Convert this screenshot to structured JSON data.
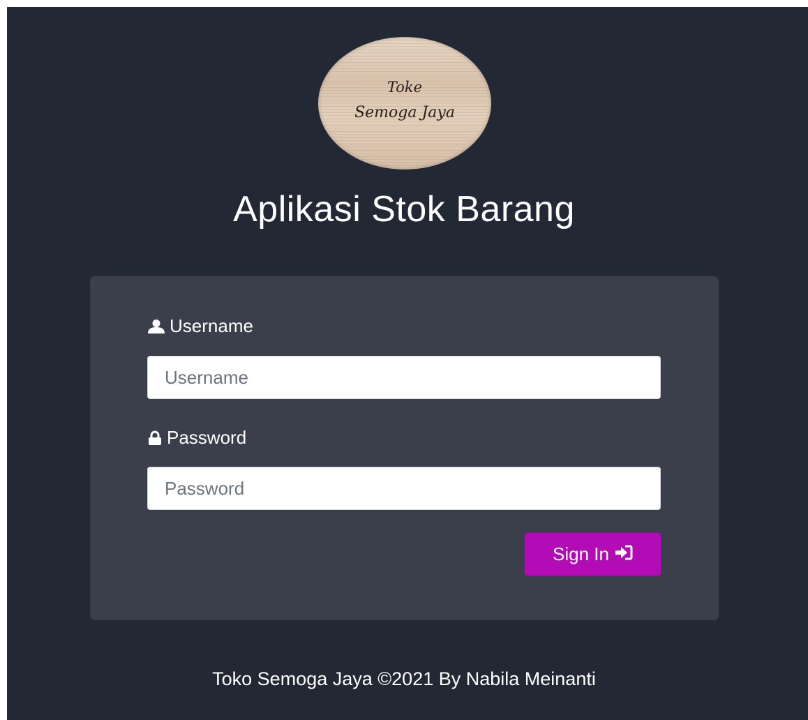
{
  "logo": {
    "line1": "Toke",
    "line2": "Semoga Jaya"
  },
  "header": {
    "title": "Aplikasi Stok Barang"
  },
  "form": {
    "username_label": "Username",
    "username_placeholder": "Username",
    "username_value": "",
    "password_label": "Password",
    "password_placeholder": "Password",
    "password_value": "",
    "submit_label": "Sign In",
    "icons": {
      "username": "user-icon",
      "password": "lock-icon",
      "submit": "sign-in-icon"
    }
  },
  "footer": {
    "text": "Toko Semoga Jaya ©2021 By Nabila Meinanti"
  },
  "colors": {
    "page_background": "#222834",
    "card_background": "#3a3f4b",
    "button_accent": "#b30bb5",
    "text": "#ffffff"
  }
}
